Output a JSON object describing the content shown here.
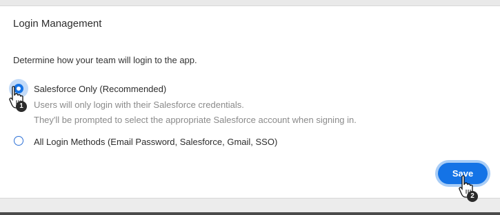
{
  "section": {
    "title": "Login Management",
    "description": "Determine how your team will login to the app."
  },
  "options": [
    {
      "label": "Salesforce Only (Recommended)",
      "selected": true,
      "help_line_1": "Users will only login with their Salesforce credentials.",
      "help_line_2": "They'll be prompted to select the appropriate Salesforce account when signing in."
    },
    {
      "label": "All Login Methods (Email Password, Salesforce, Gmail, SSO)",
      "selected": false
    }
  ],
  "actions": {
    "save_label": "Save"
  },
  "cursors": [
    {
      "icon": "hand-pointer-icon",
      "step": "1"
    },
    {
      "icon": "hand-pointer-icon",
      "step": "2"
    }
  ],
  "colors": {
    "accent": "#1473e6",
    "highlight": "#bcd7f7"
  }
}
